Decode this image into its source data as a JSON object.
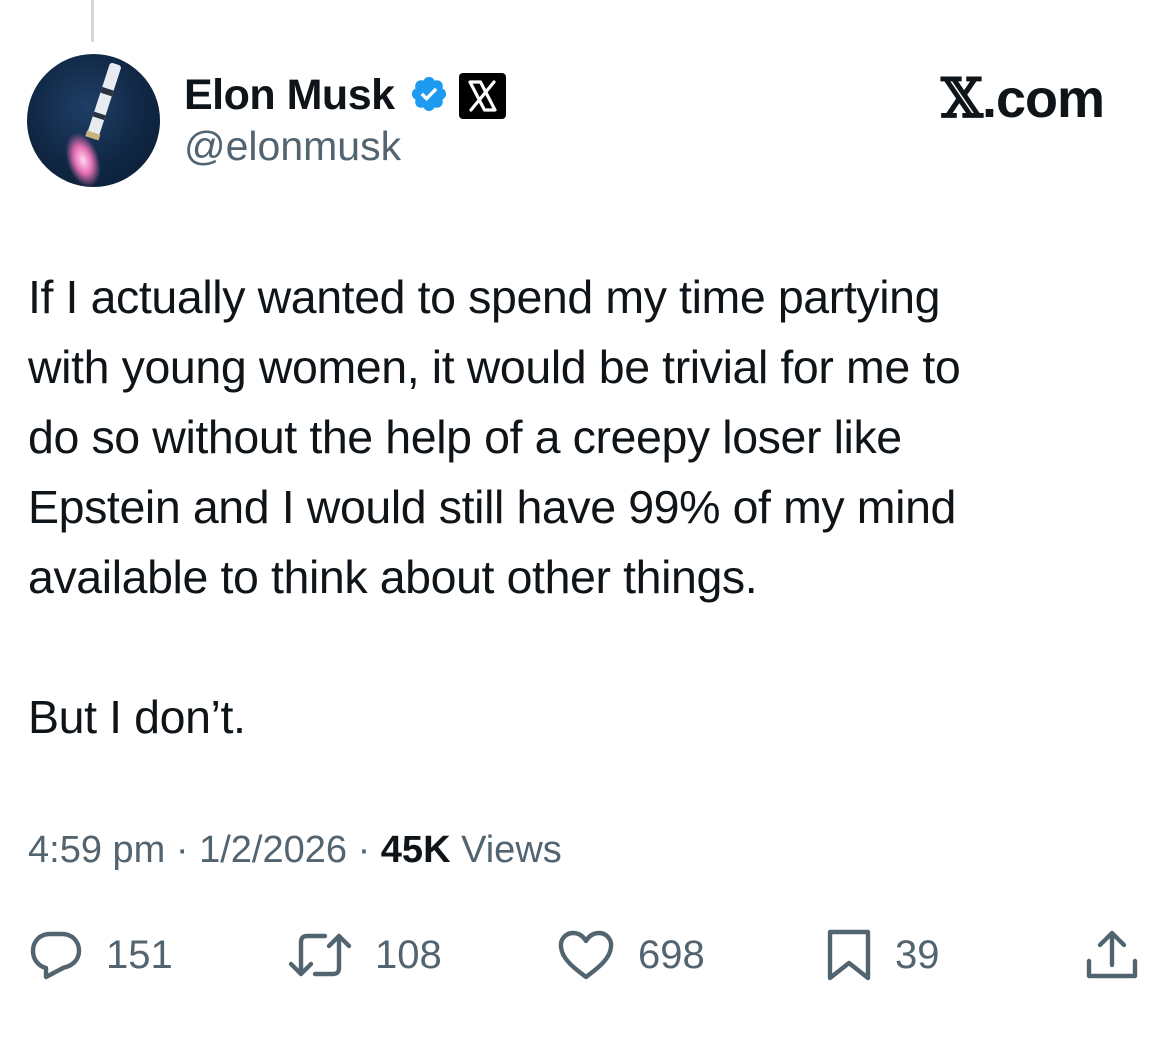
{
  "header": {
    "display_name": "Elon Musk",
    "handle": "@elonmusk",
    "site_label": ".com",
    "site_glyph": "𝕏",
    "affiliate_glyph": "𝕏"
  },
  "tweet": {
    "paragraph1_lines": [
      "If I actually wanted to spend my time partying",
      "with young women, it would be trivial for me to",
      "do so without the help of a creepy loser like",
      "Epstein and I would still have 99% of my mind",
      "available to think about other things."
    ],
    "paragraph2": "But I don’t."
  },
  "meta": {
    "time": "4:59 pm",
    "separator": "·",
    "date": "1/2/2026",
    "views_count": "45K",
    "views_label": "Views"
  },
  "actions": {
    "replies": "151",
    "reposts": "108",
    "likes": "698",
    "bookmarks": "39"
  },
  "icons": {
    "verified": "verified-badge-icon",
    "affiliate": "x-logo-icon",
    "reply": "reply-icon",
    "repost": "repost-icon",
    "like": "heart-icon",
    "bookmark": "bookmark-icon",
    "share": "share-icon"
  },
  "colors": {
    "text_primary": "#0f1419",
    "text_secondary": "#536471",
    "verified_blue": "#1d9bf0"
  }
}
